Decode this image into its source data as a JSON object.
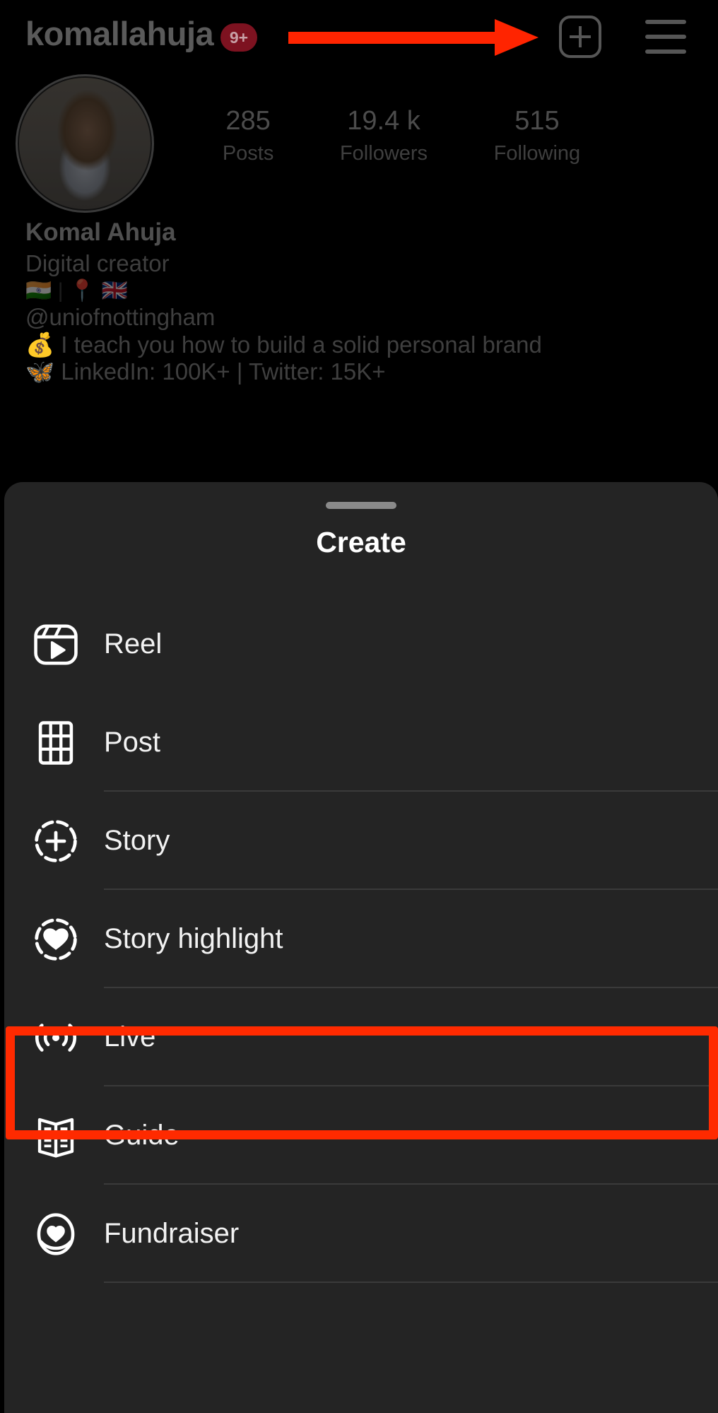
{
  "header": {
    "username": "komallahuja",
    "notification_badge": "9+",
    "add_icon": "plus-square-icon",
    "menu_icon": "hamburger-menu-icon"
  },
  "annotation": {
    "arrow_color": "#ff2400",
    "highlight_color": "#ff2a00"
  },
  "profile": {
    "avatar_alt": "profile-photo",
    "stats": [
      {
        "value": "285",
        "label": "Posts"
      },
      {
        "value": "19.4 k",
        "label": "Followers"
      },
      {
        "value": "515",
        "label": "Following"
      }
    ],
    "display_name": "Komal Ahuja",
    "category": "Digital creator",
    "bio_lines": [
      "🇮🇳 | 📍 🇬🇧",
      "@uniofnottingham",
      "💰 I teach you how to build a solid personal brand",
      "🦋 LinkedIn: 100K+ | Twitter: 15K+"
    ]
  },
  "sheet": {
    "title": "Create",
    "grabber": "drag-handle",
    "items": [
      {
        "label": "Reel",
        "icon": "reel-icon",
        "highlighted": true
      },
      {
        "label": "Post",
        "icon": "grid-post-icon",
        "highlighted": false
      },
      {
        "label": "Story",
        "icon": "story-plus-icon",
        "highlighted": false
      },
      {
        "label": "Story highlight",
        "icon": "story-highlight-icon",
        "highlighted": false
      },
      {
        "label": "Live",
        "icon": "live-broadcast-icon",
        "highlighted": false
      },
      {
        "label": "Guide",
        "icon": "guide-book-icon",
        "highlighted": false
      },
      {
        "label": "Fundraiser",
        "icon": "fundraiser-heart-icon",
        "highlighted": false
      }
    ]
  }
}
